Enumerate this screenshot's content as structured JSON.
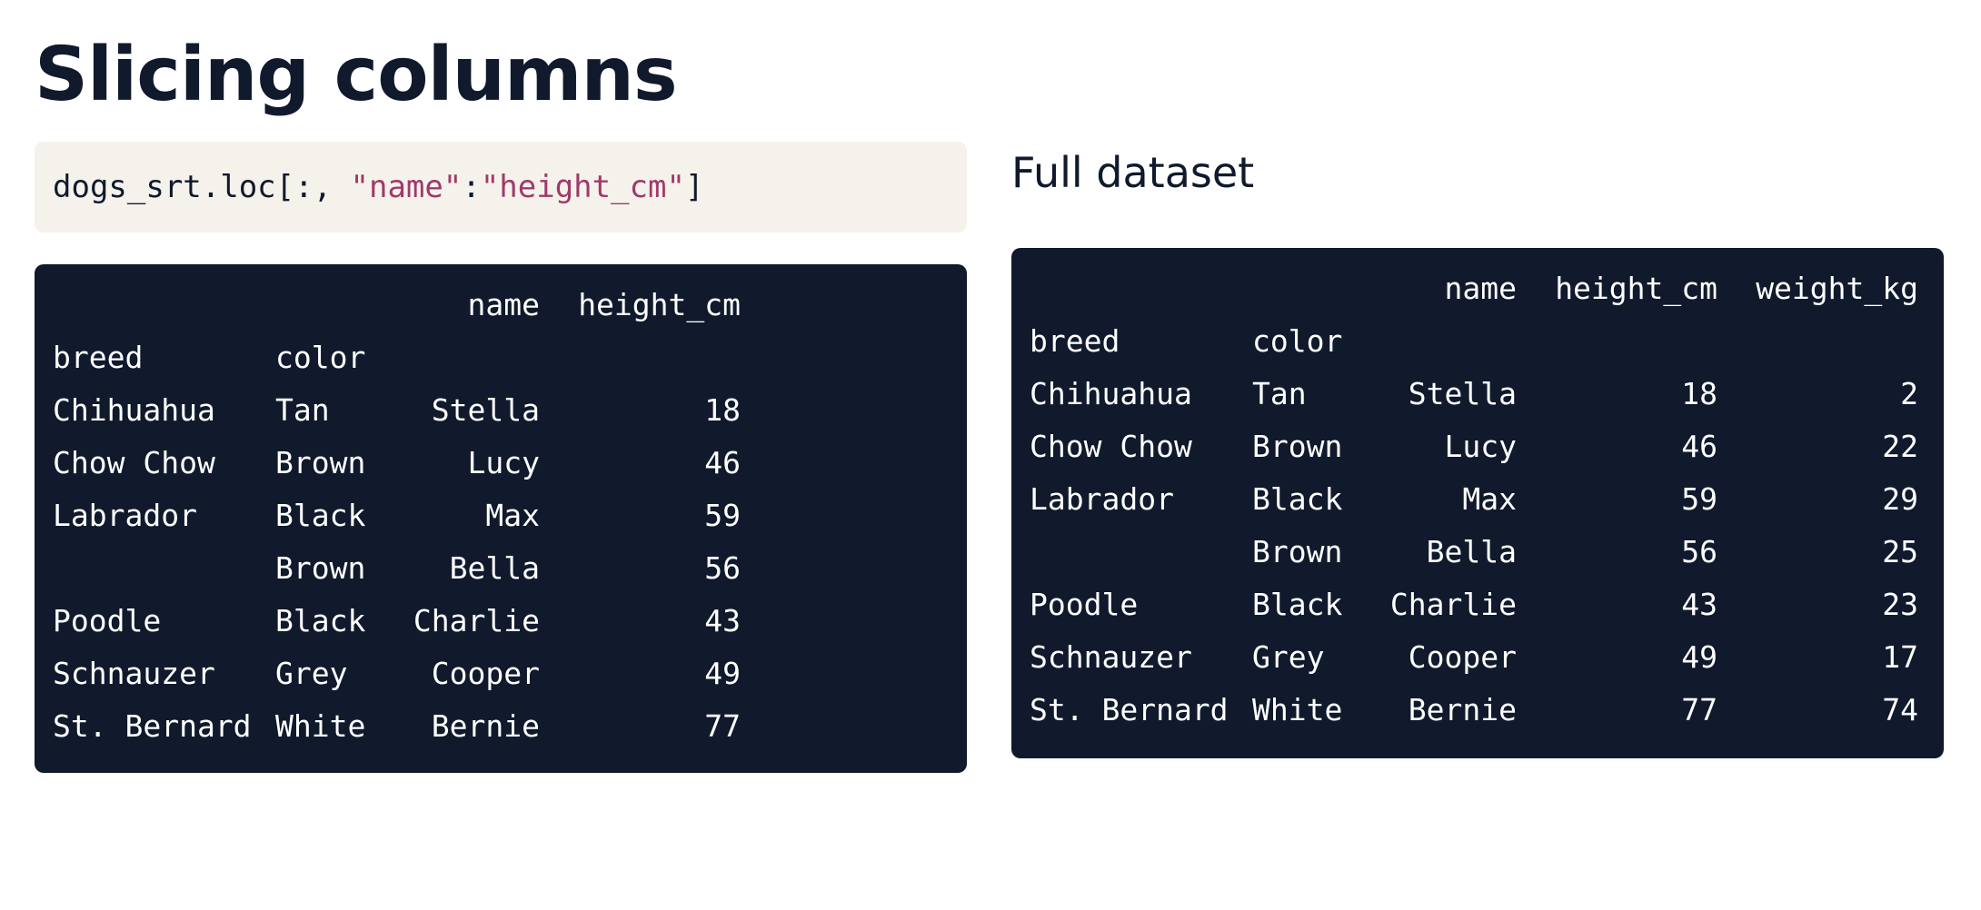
{
  "title": "Slicing columns",
  "code": {
    "prefix": "dogs_srt.loc[:, ",
    "str1": "\"name\"",
    "sep": ":",
    "str2": "\"height_cm\"",
    "suffix": "]"
  },
  "full_dataset_title": "Full dataset",
  "sliced_table": {
    "column_headers": [
      "name",
      "height_cm"
    ],
    "index_names": [
      "breed",
      "color"
    ],
    "rows": [
      {
        "breed": "Chihuahua",
        "color": "Tan",
        "name": "Stella",
        "height_cm": "18"
      },
      {
        "breed": "Chow Chow",
        "color": "Brown",
        "name": "Lucy",
        "height_cm": "46"
      },
      {
        "breed": "Labrador",
        "color": "Black",
        "name": "Max",
        "height_cm": "59"
      },
      {
        "breed": "",
        "color": "Brown",
        "name": "Bella",
        "height_cm": "56"
      },
      {
        "breed": "Poodle",
        "color": "Black",
        "name": "Charlie",
        "height_cm": "43"
      },
      {
        "breed": "Schnauzer",
        "color": "Grey",
        "name": "Cooper",
        "height_cm": "49"
      },
      {
        "breed": "St. Bernard",
        "color": "White",
        "name": "Bernie",
        "height_cm": "77"
      }
    ]
  },
  "full_table": {
    "column_headers": [
      "name",
      "height_cm",
      "weight_kg"
    ],
    "index_names": [
      "breed",
      "color"
    ],
    "rows": [
      {
        "breed": "Chihuahua",
        "color": "Tan",
        "name": "Stella",
        "height_cm": "18",
        "weight_kg": "2"
      },
      {
        "breed": "Chow Chow",
        "color": "Brown",
        "name": "Lucy",
        "height_cm": "46",
        "weight_kg": "22"
      },
      {
        "breed": "Labrador",
        "color": "Black",
        "name": "Max",
        "height_cm": "59",
        "weight_kg": "29"
      },
      {
        "breed": "",
        "color": "Brown",
        "name": "Bella",
        "height_cm": "56",
        "weight_kg": "25"
      },
      {
        "breed": "Poodle",
        "color": "Black",
        "name": "Charlie",
        "height_cm": "43",
        "weight_kg": "23"
      },
      {
        "breed": "Schnauzer",
        "color": "Grey",
        "name": "Cooper",
        "height_cm": "49",
        "weight_kg": "17"
      },
      {
        "breed": "St. Bernard",
        "color": "White",
        "name": "Bernie",
        "height_cm": "77",
        "weight_kg": "74"
      }
    ]
  },
  "colors": {
    "dark_bg": "#101a2c",
    "code_bg": "#f5f2ec",
    "string": "#a03a6a"
  }
}
